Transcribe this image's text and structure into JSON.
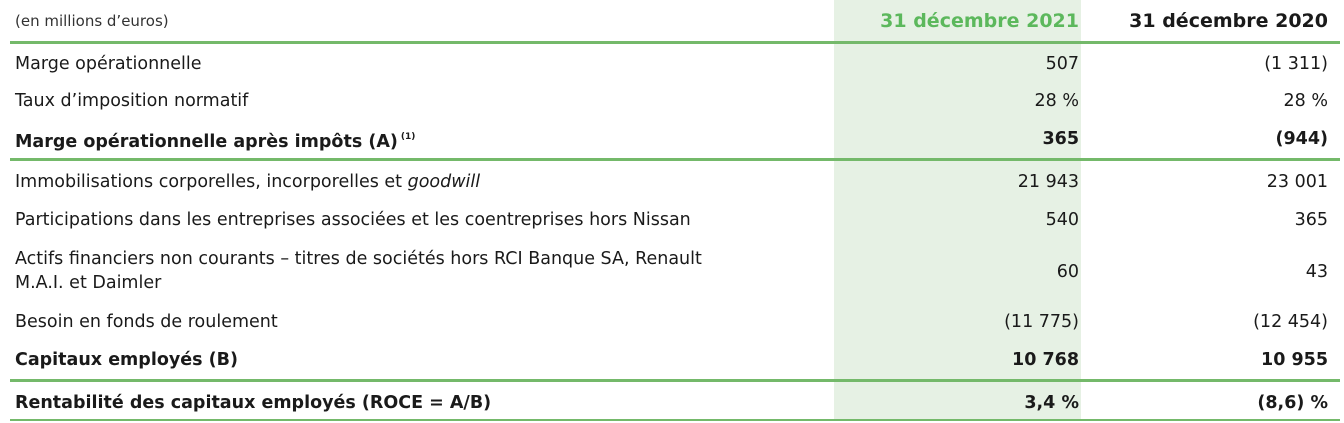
{
  "header": {
    "unit_note": "(en millions d’euros)",
    "col_2021": "31 décembre 2021",
    "col_2020": "31 décembre 2020"
  },
  "rows": [
    {
      "label": "Marge opérationnelle",
      "v2021": "507",
      "v2020": "(1 311)"
    },
    {
      "label": "Taux d’imposition normatif",
      "v2021": "28 %",
      "v2020": "28 %"
    },
    {
      "label": "Marge opérationnelle après impôts (A)",
      "footnote": "(1)",
      "v2021": "365",
      "v2020": "(944)"
    },
    {
      "label_prefix": "Immobilisations corporelles, incorporelles et ",
      "label_italic": "goodwill",
      "v2021": "21 943",
      "v2020": "23 001"
    },
    {
      "label": "Participations dans les entreprises associées et les coentreprises hors Nissan",
      "v2021": "540",
      "v2020": "365"
    },
    {
      "label_line1": "Actifs financiers non courants – titres de sociétés hors RCI Banque SA, Renault",
      "label_line2": "M.A.I. et Daimler",
      "v2021": "60",
      "v2020": "43"
    },
    {
      "label": "Besoin en fonds de roulement",
      "v2021": "(11 775)",
      "v2020": "(12 454)"
    },
    {
      "label": "Capitaux employés (B)",
      "v2021": "10 768",
      "v2020": "10 955"
    },
    {
      "label": "Rentabilité des capitaux employés (ROCE = A/B)",
      "v2021": "3,4 %",
      "v2020": "(8,6) %"
    }
  ],
  "colors": {
    "accent_green": "#5cb85c",
    "highlight_bg": "#e6f1e4",
    "rule_green": "#74b96a"
  }
}
